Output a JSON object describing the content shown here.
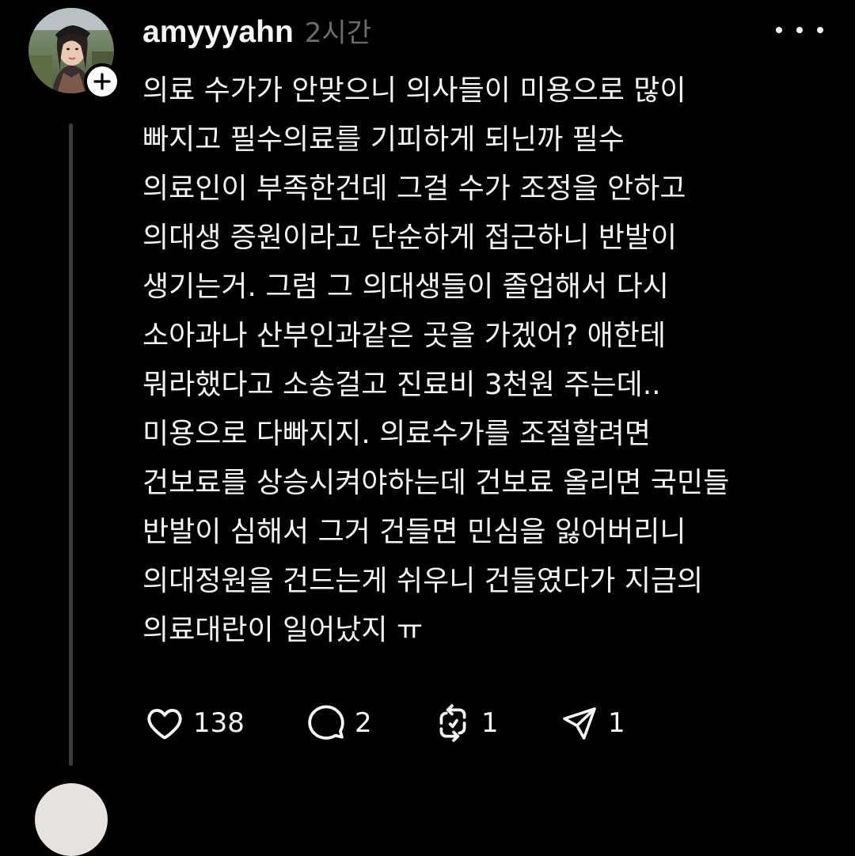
{
  "post": {
    "username": "amyyyahn",
    "timestamp": "2시간",
    "avatar_icon": "profile-photo",
    "follow_icon": "plus-icon",
    "more_icon": "more-horizontal-icon",
    "text_lines": [
      "의료 수가가 안맞으니 의사들이 미용으로 많이",
      "빠지고 필수의료를 기피하게 되닌까 필수",
      "의료인이 부족한건데 그걸 수가 조정을 안하고",
      "의대생 증원이라고 단순하게 접근하니 반발이",
      "생기는거. 그럼 그 의대생들이 졸업해서 다시",
      "소아과나 산부인과같은 곳을 가겠어? 애한테",
      "뭐라했다고 소송걸고 진료비 3천원 주는데..",
      "미용으로 다빠지지. 의료수가를 조절할려면",
      "건보료를 상승시켜야하는데 건보료 올리면 국민들",
      "반발이 심해서 그거 건들면 민심을 잃어버리니",
      "의대정원을 건드는게 쉬우니 건들였다가 지금의",
      "의료대란이 일어났지 ㅠ"
    ],
    "actions": {
      "like": {
        "icon": "heart-icon",
        "count": "138"
      },
      "comment": {
        "icon": "comment-icon",
        "count": "2"
      },
      "repost": {
        "icon": "repost-icon",
        "count": "1"
      },
      "share": {
        "icon": "send-icon",
        "count": "1"
      }
    }
  },
  "colors": {
    "background": "#000000",
    "text": "#f3f5f7",
    "muted": "#6b6b6b",
    "thread_line": "#3b3b3b"
  }
}
